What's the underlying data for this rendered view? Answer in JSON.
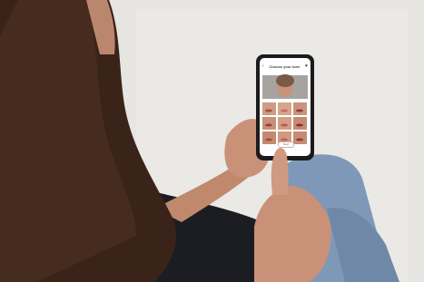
{
  "app": {
    "title": "Choose your tone",
    "next_label": "Next",
    "icons": {
      "back": "back-arrow-icon",
      "favorite": "heart-icon",
      "share": "share-icon"
    },
    "swatch_count": 9
  },
  "colors": {
    "wall": "#f0eeeb",
    "floor": "#d9d6d1",
    "jeans": "#7f98b8",
    "hair": "#3a2419",
    "skin": "#c99278",
    "top": "#1c1d22",
    "phone_body": "#1b1b1d",
    "screen_bg": "#ffffff",
    "lip_tone_1": "#b7463f",
    "lip_tone_2": "#c8705f",
    "lip_tone_3": "#9a3338"
  }
}
